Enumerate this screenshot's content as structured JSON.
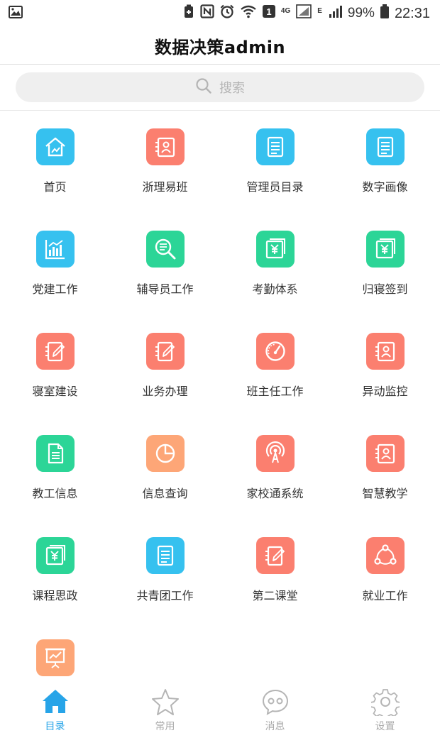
{
  "status_bar": {
    "net_label": "4G",
    "net2_label": "E",
    "battery": "99%",
    "time": "22:31",
    "alarm_badge": "1"
  },
  "header": {
    "title": "数据决策admin"
  },
  "search": {
    "placeholder": "搜索",
    "icon": "search-icon"
  },
  "colors": {
    "blue": "#36c1ef",
    "red": "#fb7f6f",
    "green": "#2cd597",
    "orange": "#fda677",
    "nav_active": "#27a4e8",
    "nav_inactive": "#b5b5b5"
  },
  "grid": {
    "items": [
      {
        "label": "首页",
        "icon": "home-chart-icon",
        "color": "blue"
      },
      {
        "label": "浙理易班",
        "icon": "contact-card-icon",
        "color": "red"
      },
      {
        "label": "管理员目录",
        "icon": "document-list-icon",
        "color": "blue"
      },
      {
        "label": "数字画像",
        "icon": "document-list-icon",
        "color": "blue"
      },
      {
        "label": "党建工作",
        "icon": "bar-chart-icon",
        "color": "blue"
      },
      {
        "label": "辅导员工作",
        "icon": "search-list-icon",
        "color": "green"
      },
      {
        "label": "考勤体系",
        "icon": "yen-doc-icon",
        "color": "green"
      },
      {
        "label": "归寝签到",
        "icon": "yen-doc-icon",
        "color": "green"
      },
      {
        "label": "寝室建设",
        "icon": "edit-note-icon",
        "color": "red"
      },
      {
        "label": "业务办理",
        "icon": "edit-note-icon",
        "color": "red"
      },
      {
        "label": "班主任工作",
        "icon": "gauge-icon",
        "color": "red"
      },
      {
        "label": "异动监控",
        "icon": "contact-card-icon",
        "color": "red"
      },
      {
        "label": "教工信息",
        "icon": "document-icon",
        "color": "green"
      },
      {
        "label": "信息查询",
        "icon": "pie-chart-icon",
        "color": "orange"
      },
      {
        "label": "家校通系统",
        "icon": "broadcast-icon",
        "color": "red"
      },
      {
        "label": "智慧教学",
        "icon": "contact-card-icon",
        "color": "red"
      },
      {
        "label": "课程思政",
        "icon": "yen-doc-icon",
        "color": "green"
      },
      {
        "label": "共青团工作",
        "icon": "document-list-icon",
        "color": "blue"
      },
      {
        "label": "第二课堂",
        "icon": "edit-note-icon",
        "color": "red"
      },
      {
        "label": "就业工作",
        "icon": "share-icon",
        "color": "red"
      },
      {
        "label": "",
        "icon": "presentation-icon",
        "color": "orange"
      }
    ]
  },
  "bottom_nav": {
    "items": [
      {
        "label": "目录",
        "icon": "home-icon",
        "active": true
      },
      {
        "label": "常用",
        "icon": "star-icon",
        "active": false
      },
      {
        "label": "消息",
        "icon": "message-icon",
        "active": false
      },
      {
        "label": "设置",
        "icon": "gear-icon",
        "active": false
      }
    ]
  }
}
